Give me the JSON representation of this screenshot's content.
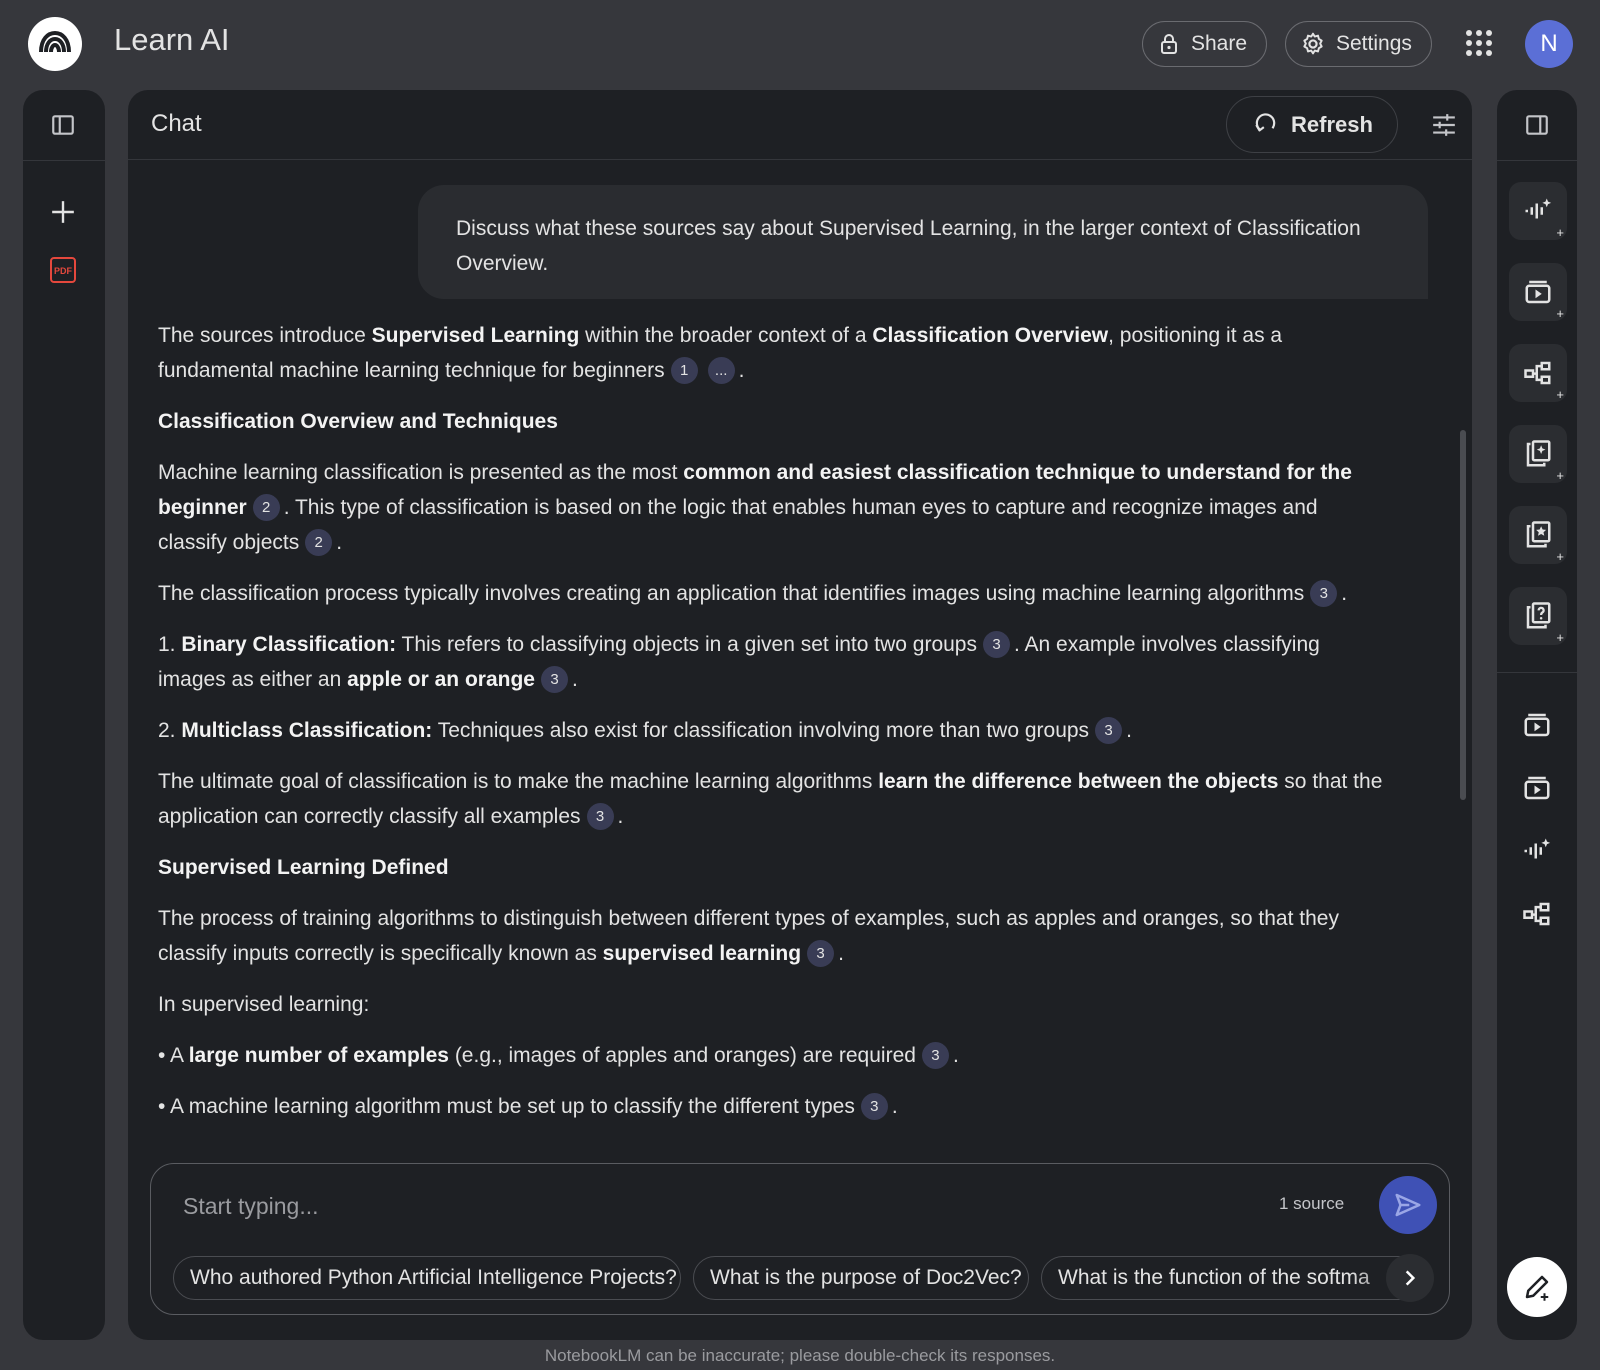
{
  "app": {
    "title": "Learn AI",
    "avatar_letter": "N"
  },
  "header": {
    "share_label": "Share",
    "settings_label": "Settings"
  },
  "chat": {
    "title": "Chat",
    "refresh_label": "Refresh",
    "user_message": "Discuss what these sources say about Supervised Learning, in the larger context of Classification Overview."
  },
  "response": {
    "p1": {
      "t1": "The sources introduce ",
      "b1": "Supervised Learning",
      "t2": " within the broader context of a ",
      "b2": "Classification Overview",
      "t3": ", positioning it as a fundamental machine learning technique for beginners",
      "c1": "1",
      "c2": "...",
      "t4": "."
    },
    "h1": "Classification Overview and Techniques",
    "p2": {
      "t1": "Machine learning classification is presented as the most ",
      "b1": "common and easiest classification technique to understand for the beginner",
      "c1": "2",
      "t2": ". This type of classification is based on the logic that enables human eyes to capture and recognize images and classify objects",
      "c2": "2",
      "t3": "."
    },
    "p3": {
      "t1": "The classification process typically involves creating an application that identifies images using machine learning algorithms",
      "c1": "3",
      "t2": "."
    },
    "p4": {
      "t0": "1. ",
      "b1": "Binary Classification:",
      "t1": " This refers to classifying objects in a given set into two groups",
      "c1": "3",
      "t2": ". An example involves classifying images as either an ",
      "b2": "apple or an orange",
      "c2": "3",
      "t3": "."
    },
    "p5": {
      "t0": "2. ",
      "b1": "Multiclass Classification:",
      "t1": " Techniques also exist for classification involving more than two groups",
      "c1": "3",
      "t2": "."
    },
    "p6": {
      "t1": "The ultimate goal of classification is to make the machine learning algorithms ",
      "b1": "learn the difference between the objects",
      "t2": " so that the application can correctly classify all examples",
      "c1": "3",
      "t3": "."
    },
    "h2": "Supervised Learning Defined",
    "p7": {
      "t1": "The process of training algorithms to distinguish between different types of examples, such as apples and oranges, so that they classify inputs correctly is specifically known as ",
      "b1": "supervised learning",
      "c1": "3",
      "t2": "."
    },
    "p8": "In supervised learning:",
    "p9": {
      "t1": "• A ",
      "b1": "large number of examples",
      "t2": " (e.g., images of apples and oranges) are required",
      "c1": "3",
      "t3": "."
    },
    "p10": {
      "t1": "• A machine learning algorithm must be set up to classify the different types",
      "c1": "3",
      "t2": "."
    }
  },
  "input": {
    "placeholder": "Start typing...",
    "source_count": "1 source",
    "suggestions": [
      "Who authored Python Artificial Intelligence Projects?",
      "What is the purpose of Doc2Vec?",
      "What is the function of the softma"
    ]
  },
  "footer": {
    "note": "NotebookLM can be inaccurate; please double-check its responses."
  },
  "left_rail": {
    "pdf_label": "PDF"
  },
  "icons": {
    "left": [
      "panel-toggle-icon",
      "add-icon",
      "pdf-icon"
    ],
    "right": [
      "panel-toggle-icon",
      "audio-overview-icon",
      "video-overview-icon",
      "mind-map-icon",
      "reports-icon",
      "flashcards-icon",
      "quiz-icon",
      "video-icon",
      "video-icon",
      "audio-icon",
      "mind-map-icon",
      "edit-note-icon"
    ]
  },
  "colors": {
    "background": "#36373c",
    "panel": "#1e2024",
    "citation": "#393c55",
    "send": "#3f51b5",
    "avatar": "#5b6fd6",
    "pdf": "#e5483d"
  }
}
